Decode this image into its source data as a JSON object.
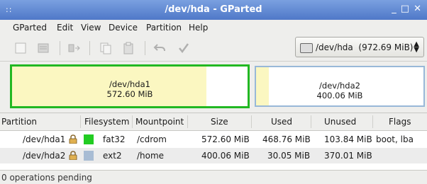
{
  "window": {
    "title": "/dev/hda - GParted",
    "grip": "::",
    "buttons": {
      "minimize": "_",
      "maximize": "□",
      "close": "✕"
    }
  },
  "menu": {
    "items": [
      {
        "label": "GParted"
      },
      {
        "label": "Edit"
      },
      {
        "label": "View"
      },
      {
        "label": "Device"
      },
      {
        "label": "Partition"
      },
      {
        "label": "Help"
      }
    ]
  },
  "toolbar": {
    "buttons": [
      {
        "name": "new-partition",
        "enabled": false
      },
      {
        "name": "delete-partition",
        "enabled": false
      },
      {
        "name": "resize-move",
        "enabled": false
      },
      {
        "name": "copy",
        "enabled": false
      },
      {
        "name": "paste",
        "enabled": false
      },
      {
        "name": "undo",
        "enabled": false
      },
      {
        "name": "apply",
        "enabled": false
      }
    ]
  },
  "device_selector": {
    "value": "/dev/hda  (972.69 MiB)"
  },
  "disk_map": {
    "partitions": [
      {
        "name": "/dev/hda1",
        "size": "572.60 MiB",
        "used_fraction": 0.82,
        "selected": true,
        "color": "#22b822"
      },
      {
        "name": "/dev/hda2",
        "size": "400.06 MiB",
        "used_fraction": 0.08,
        "selected": false,
        "color": "#98b8d8"
      }
    ]
  },
  "table": {
    "columns": [
      "Partition",
      "Filesystem",
      "Mountpoint",
      "Size",
      "Used",
      "Unused",
      "Flags"
    ],
    "rows": [
      {
        "partition": "/dev/hda1",
        "fs_color": "#22cc22",
        "filesystem": "fat32",
        "mountpoint": "/cdrom",
        "size": "572.60 MiB",
        "used": "468.76 MiB",
        "unused": "103.84 MiB",
        "flags": "boot, lba"
      },
      {
        "partition": "/dev/hda2",
        "fs_color": "#a8bcd4",
        "filesystem": "ext2",
        "mountpoint": "/home",
        "size": "400.06 MiB",
        "used": "30.05 MiB",
        "unused": "370.01 MiB",
        "flags": ""
      }
    ]
  },
  "status": {
    "text": "0 operations pending"
  }
}
